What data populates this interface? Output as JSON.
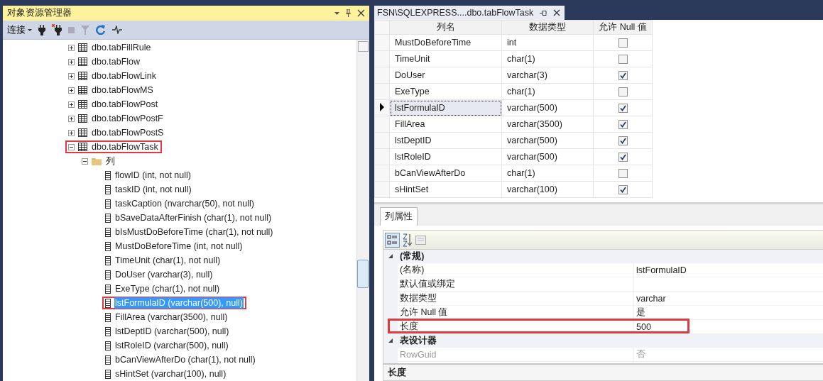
{
  "explorer": {
    "title": "对象资源管理器",
    "toolbar": {
      "connect_label": "连接"
    },
    "tree": [
      {
        "kind": "table",
        "label": "dbo.tabFillRule",
        "expanded": false,
        "highlighted": false
      },
      {
        "kind": "table",
        "label": "dbo.tabFlow",
        "expanded": false,
        "highlighted": false
      },
      {
        "kind": "table",
        "label": "dbo.tabFlowLink",
        "expanded": false,
        "highlighted": false
      },
      {
        "kind": "table",
        "label": "dbo.tabFlowMS",
        "expanded": false,
        "highlighted": false
      },
      {
        "kind": "table",
        "label": "dbo.tabFlowPost",
        "expanded": false,
        "highlighted": false
      },
      {
        "kind": "table",
        "label": "dbo.tabFlowPostF",
        "expanded": false,
        "highlighted": false
      },
      {
        "kind": "table",
        "label": "dbo.tabFlowPostS",
        "expanded": false,
        "highlighted": false
      },
      {
        "kind": "table",
        "label": "dbo.tabFlowTask",
        "expanded": true,
        "highlighted": true,
        "children": [
          {
            "kind": "folder",
            "label": "列",
            "expanded": true,
            "highlighted": false,
            "children": [
              {
                "kind": "column",
                "label": "flowID (int, not null)",
                "selected": false,
                "highlighted": false
              },
              {
                "kind": "column",
                "label": "taskID (int, not null)",
                "selected": false,
                "highlighted": false
              },
              {
                "kind": "column",
                "label": "taskCaption (nvarchar(50), not null)",
                "selected": false,
                "highlighted": false
              },
              {
                "kind": "column",
                "label": "bSaveDataAfterFinish (char(1), not null)",
                "selected": false,
                "highlighted": false
              },
              {
                "kind": "column",
                "label": "bIsMustDoBeforeTime (char(1), not null)",
                "selected": false,
                "highlighted": false
              },
              {
                "kind": "column",
                "label": "MustDoBeforeTime (int, not null)",
                "selected": false,
                "highlighted": false
              },
              {
                "kind": "column",
                "label": "TimeUnit (char(1), not null)",
                "selected": false,
                "highlighted": false
              },
              {
                "kind": "column",
                "label": "DoUser (varchar(3), null)",
                "selected": false,
                "highlighted": false
              },
              {
                "kind": "column",
                "label": "ExeType (char(1), not null)",
                "selected": false,
                "highlighted": false
              },
              {
                "kind": "column",
                "label": "lstFormulaID (varchar(500), null)",
                "selected": true,
                "highlighted": true
              },
              {
                "kind": "column",
                "label": "FillArea (varchar(3500), null)",
                "selected": false,
                "highlighted": false
              },
              {
                "kind": "column",
                "label": "lstDeptID (varchar(500), null)",
                "selected": false,
                "highlighted": false
              },
              {
                "kind": "column",
                "label": "lstRoleID (varchar(500), null)",
                "selected": false,
                "highlighted": false
              },
              {
                "kind": "column",
                "label": "bCanViewAfterDo (char(1), not null)",
                "selected": false,
                "highlighted": false
              },
              {
                "kind": "column",
                "label": "sHintSet (varchar(100), null)",
                "selected": false,
                "highlighted": false
              }
            ]
          }
        ]
      }
    ]
  },
  "designer": {
    "tab": {
      "title": "FSN\\SQLEXPRESS....dbo.tabFlowTask"
    },
    "grid": {
      "columns": [
        "列名",
        "数据类型",
        "允许 Null 值"
      ],
      "rows": [
        {
          "name": "MustDoBeforeTime",
          "type": "int",
          "allow_null": false,
          "selected": false
        },
        {
          "name": "TimeUnit",
          "type": "char(1)",
          "allow_null": false,
          "selected": false
        },
        {
          "name": "DoUser",
          "type": "varchar(3)",
          "allow_null": true,
          "selected": false
        },
        {
          "name": "ExeType",
          "type": "char(1)",
          "allow_null": false,
          "selected": false
        },
        {
          "name": "lstFormulaID",
          "type": "varchar(500)",
          "allow_null": true,
          "selected": true
        },
        {
          "name": "FillArea",
          "type": "varchar(3500)",
          "allow_null": true,
          "selected": false
        },
        {
          "name": "lstDeptID",
          "type": "varchar(500)",
          "allow_null": true,
          "selected": false
        },
        {
          "name": "lstRoleID",
          "type": "varchar(500)",
          "allow_null": true,
          "selected": false
        },
        {
          "name": "bCanViewAfterDo",
          "type": "char(1)",
          "allow_null": false,
          "selected": false
        },
        {
          "name": "sHintSet",
          "type": "varchar(100)",
          "allow_null": true,
          "selected": false
        }
      ]
    },
    "properties": {
      "tab": "列属性",
      "categories": [
        {
          "label": "(常规)",
          "expanded": true,
          "rows": [
            {
              "name": "(名称)",
              "value": "lstFormulaID",
              "disabled": false,
              "highlighted": false
            },
            {
              "name": "默认值或绑定",
              "disabled": false,
              "highlighted": false
            },
            {
              "name": "数据类型",
              "value": "varchar",
              "disabled": false,
              "highlighted": false
            },
            {
              "name": "允许 Null 值",
              "value": "是",
              "disabled": false,
              "highlighted": false
            },
            {
              "name": "长度",
              "value": "500",
              "disabled": false,
              "highlighted": true
            }
          ]
        },
        {
          "label": "表设计器",
          "expanded": true,
          "rows": [
            {
              "name": "RowGuid",
              "value": "否",
              "disabled": true,
              "highlighted": false
            }
          ]
        }
      ],
      "description": "长度"
    }
  }
}
